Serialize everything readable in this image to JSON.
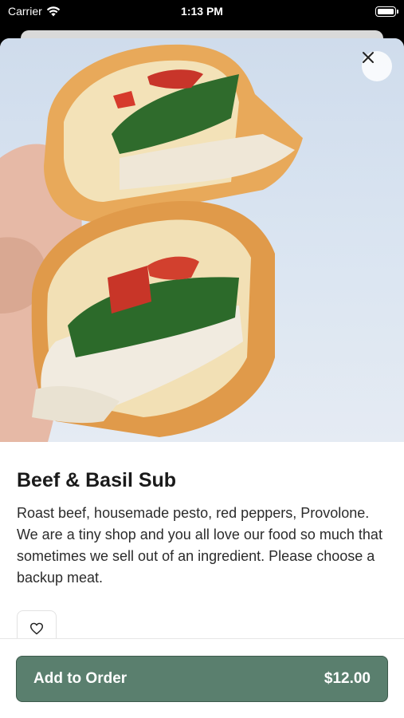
{
  "status_bar": {
    "carrier": "Carrier",
    "time": "1:13 PM"
  },
  "item": {
    "name": "Beef & Basil Sub",
    "description": "Roast beef, housemade pesto, red peppers, Provolone. We are a tiny shop and you all love our food so much that sometimes we sell out of an ingredient. Please choose a backup meat."
  },
  "footer": {
    "add_label": "Add to Order",
    "price": "$12.00"
  },
  "icons": {
    "close": "close-icon",
    "favorite": "heart-icon",
    "wifi": "wifi-icon",
    "battery": "battery-icon"
  },
  "colors": {
    "primary_button": "#5a7f6e",
    "primary_button_border": "#3d5a4c",
    "background": "#ffffff"
  }
}
